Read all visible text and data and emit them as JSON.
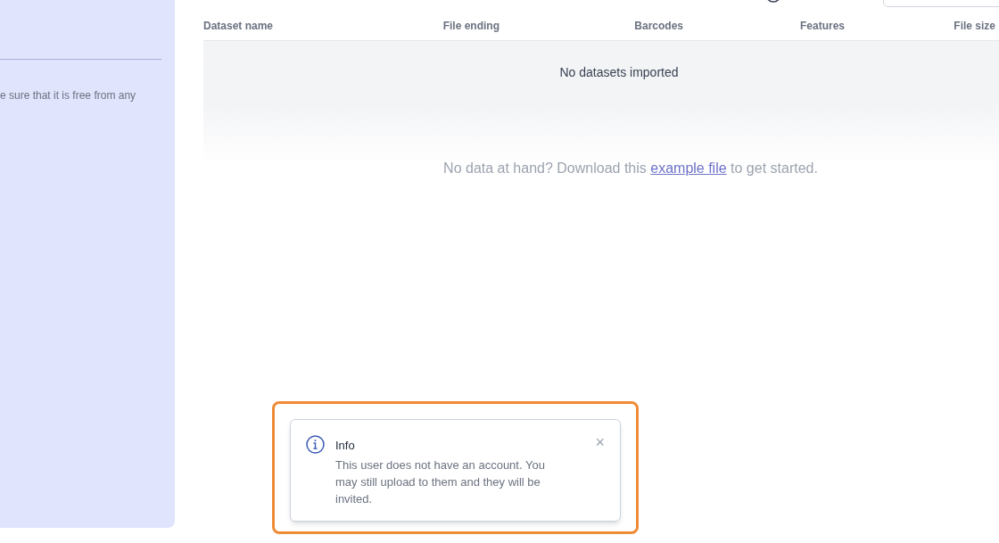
{
  "sidebar": {
    "note": "e sure that it is free from any"
  },
  "table": {
    "columns": [
      "Dataset name",
      "File ending",
      "Barcodes",
      "Features",
      "File size"
    ],
    "empty_message": "No datasets imported"
  },
  "hint": {
    "before": "No data at hand? Download this ",
    "link": "example file",
    "after": " to get started."
  },
  "toast": {
    "title": "Info",
    "message": "This user does not have an account. You may still upload to them and they will be invited.",
    "close": "×"
  }
}
